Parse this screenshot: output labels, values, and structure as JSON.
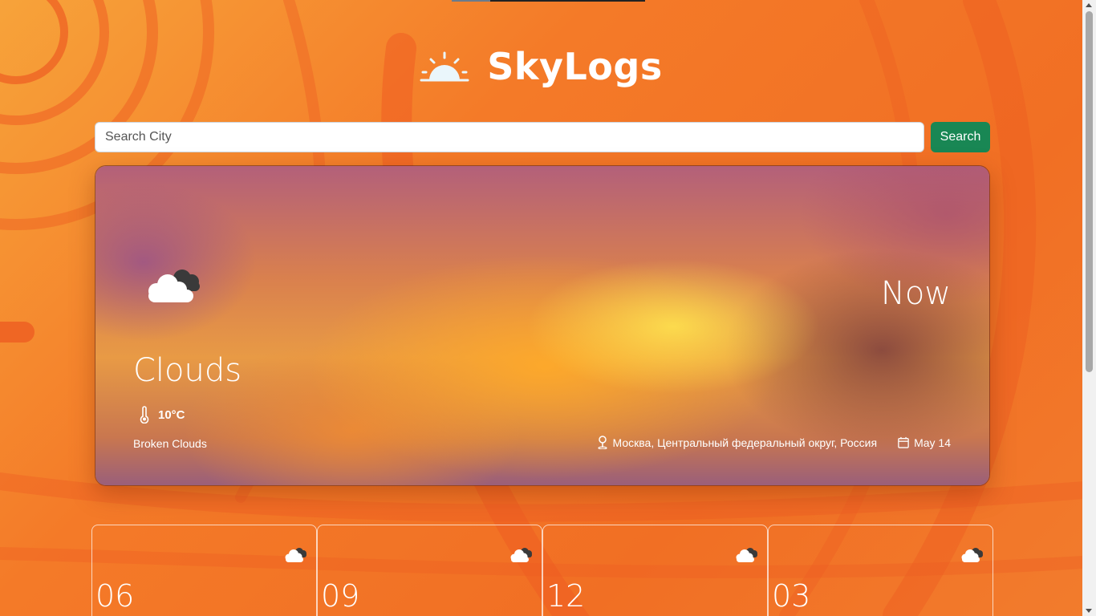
{
  "brand": {
    "name": "SkyLogs",
    "icon": "sunrise-icon"
  },
  "search": {
    "placeholder": "Search City",
    "value": "",
    "button_label": "Search"
  },
  "current": {
    "label": "Now",
    "condition": "Clouds",
    "temperature": "10°C",
    "description": "Broken Clouds",
    "location": "Москва, Центральный федеральный округ, Россия",
    "date": "May 14",
    "icon": "broken-clouds-icon"
  },
  "forecast": [
    {
      "hour": "06",
      "icon": "broken-clouds-icon"
    },
    {
      "hour": "09",
      "icon": "broken-clouds-icon"
    },
    {
      "hour": "12",
      "icon": "broken-clouds-icon"
    },
    {
      "hour": "03",
      "icon": "broken-clouds-icon"
    }
  ],
  "colors": {
    "background": "#f37a2a",
    "search_button": "#198754"
  }
}
